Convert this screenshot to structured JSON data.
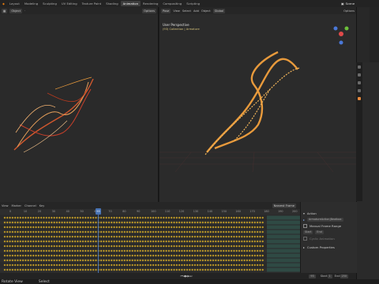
{
  "workspace_tabs": [
    "Layout",
    "Modeling",
    "Sculpting",
    "UV Editing",
    "Texture Paint",
    "Shading",
    "Animation",
    "Rendering",
    "Compositing",
    "Scripting"
  ],
  "active_tab": "Animation",
  "scene": {
    "label": "Scene"
  },
  "left_viewport": {
    "mode": "Object",
    "options": "Options"
  },
  "right_viewport": {
    "mode": "Pose",
    "menus": [
      "View",
      "Select",
      "Add",
      "Object"
    ],
    "transform": "Global",
    "options": "Options",
    "overlay_title": "User Perspective",
    "overlay_subtitle": "(93) Collection | Armature"
  },
  "dopesheet": {
    "menus": [
      "View",
      "Marker",
      "Channel",
      "Key"
    ],
    "keying_popover": "Nearest Frame",
    "ruler_ticks": [
      "0",
      "10",
      "20",
      "30",
      "40",
      "50",
      "60",
      "70",
      "80",
      "90",
      "100",
      "110",
      "120",
      "130",
      "140",
      "150",
      "160",
      "170",
      "180",
      "190",
      "200"
    ],
    "current_frame": "93"
  },
  "action_panel": {
    "title": "Action",
    "action_name": "ArmatureAction|Beatbox",
    "manual_range_label": "Manual Frame Range",
    "start": "Start",
    "end": "End",
    "cyclic_label": "Cyclic Animation",
    "custom_props": "Custom Properties"
  },
  "playback": {
    "current": "93",
    "start_label": "Start",
    "start_value": "1",
    "end_label": "End",
    "end_value": "250"
  },
  "status": {
    "left": "Rotate View",
    "mid": "Select"
  },
  "colors": {
    "accent": "#4772b3",
    "helix_wire": "#e89a3c",
    "helix_red": "#b83a1e",
    "keyframe": "#c9a227",
    "playhead": "#4772b3"
  }
}
